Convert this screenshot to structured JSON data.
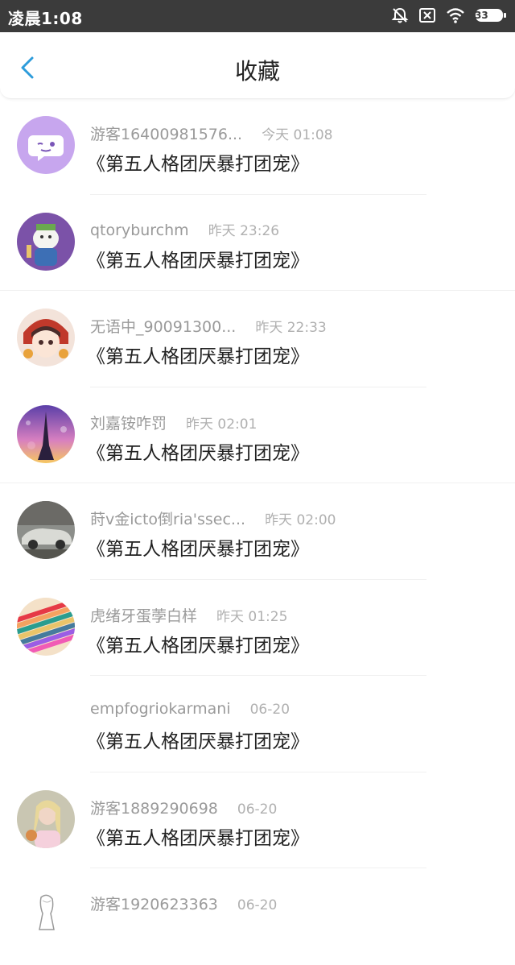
{
  "status_bar": {
    "time": "凌晨1:08",
    "battery": "33",
    "icons": [
      "alarm-off-icon",
      "sim-off-icon",
      "wifi-icon",
      "battery-icon"
    ]
  },
  "header": {
    "title": "收藏",
    "back_icon": "chevron-left-icon",
    "accent_color": "#2d9cdb"
  },
  "favorites": [
    {
      "username": "游客16400981576...",
      "time": "今天 01:08",
      "topic": "《第五人格团厌暴打团宠》",
      "avatar": "wechat-avatar"
    },
    {
      "username": "qtoryburchm",
      "time": "昨天 23:26",
      "topic": "《第五人格团厌暴打团宠》",
      "avatar": "cartoon-character-avatar"
    },
    {
      "username": "无语中_90091300...",
      "time": "昨天 22:33",
      "topic": "《第五人格团厌暴打团宠》",
      "avatar": "anime-girl-avatar"
    },
    {
      "username": "刘嘉铵咋罚",
      "time": "昨天 02:01",
      "topic": "《第五人格团厌暴打团宠》",
      "avatar": "eiffel-tower-avatar"
    },
    {
      "username": "莳v金icto倒ria'ssec...",
      "time": "昨天 02:00",
      "topic": "《第五人格团厌暴打团宠》",
      "avatar": "car-avatar"
    },
    {
      "username": "虎绪牙蛋荸白样",
      "time": "昨天 01:25",
      "topic": "《第五人格团厌暴打团宠》",
      "avatar": "colored-pencils-avatar"
    },
    {
      "username": "empfogriokarmani",
      "time": "06-20",
      "topic": "《第五人格团厌暴打团宠》",
      "avatar": "none"
    },
    {
      "username": "游客1889290698",
      "time": "06-20",
      "topic": "《第五人格团厌暴打团宠》",
      "avatar": "woman-flowers-avatar"
    },
    {
      "username": "游客1920623363",
      "time": "06-20",
      "topic": "",
      "avatar": "sketch-avatar"
    }
  ]
}
